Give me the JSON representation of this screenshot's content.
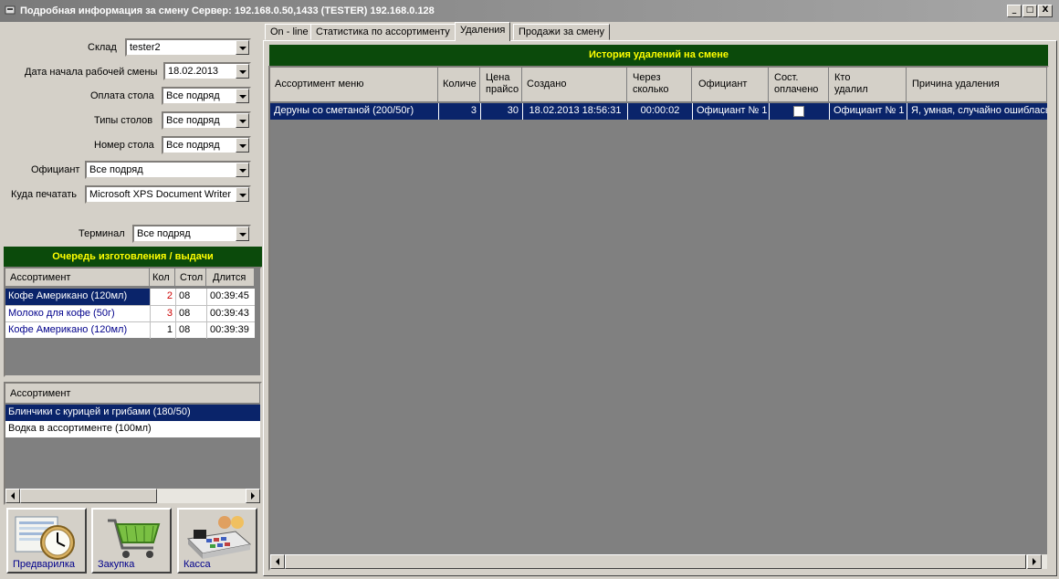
{
  "window": {
    "title": "Подробная информация за смену  Сервер: 192.168.0.50,1433 (TESTER) 192.168.0.128",
    "minimize_glyph": "_",
    "maximize_glyph": "□",
    "close_glyph": "X"
  },
  "filters": {
    "warehouse_label": "Склад",
    "warehouse_value": "tester2",
    "shift_start_label": "Дата начала рабочей смены",
    "shift_start_value": "18.02.2013",
    "table_payment_label": "Оплата стола",
    "table_payment_value": "Все подряд",
    "table_types_label": "Типы столов",
    "table_types_value": "Все подряд",
    "table_number_label": "Номер стола",
    "table_number_value": "Все подряд",
    "waiter_label": "Официант",
    "waiter_value": "Все подряд",
    "print_to_label": "Куда печатать",
    "print_to_value": "Microsoft XPS Document Writer",
    "terminal_label": "Терминал",
    "terminal_value": "Все подряд"
  },
  "queue": {
    "title": "Очередь изготовления / выдачи",
    "columns": [
      "Ассортимент",
      "Кол",
      "Стол",
      "Длится"
    ],
    "rows": [
      {
        "item": "Кофе Американо (120мл)",
        "qty": "2",
        "table": "08",
        "duration": "00:39:45"
      },
      {
        "item": "Молоко для кофе (50г)",
        "qty": "3",
        "table": "08",
        "duration": "00:39:43"
      },
      {
        "item": "Кофе Американо (120мл)",
        "qty": "1",
        "table": "08",
        "duration": "00:39:39"
      }
    ]
  },
  "assortment": {
    "column": "Ассортимент",
    "rows": [
      "Блинчики с курицей и грибами (180/50)",
      "Водка в ассортименте (100мл)"
    ]
  },
  "buttons": {
    "prebooking": "Предварилка",
    "purchase": "Закупка",
    "cashier": "Касса"
  },
  "tabs": [
    "On - line",
    "Статистика по ассортименту",
    "Удаления",
    "Продажи за смену"
  ],
  "active_tab": "Удаления",
  "deletions": {
    "title": "История удалений на смене",
    "columns": [
      "Ассортимент меню",
      "Количе",
      "Цена прайсо",
      "Создано",
      "Через сколько",
      "Официант",
      "Сост. оплачено",
      "Кто удалил",
      "Причина удаления"
    ],
    "rows": [
      {
        "item": "Деруны со сметаной (200/50г)",
        "qty": "3",
        "price": "30",
        "created": "18.02.2013 18:56:31",
        "after": "00:00:02",
        "waiter": "Официант № 1",
        "paid": false,
        "deleted_by": "Официант № 1",
        "reason": "Я, умная, случайно ошиблась"
      }
    ]
  },
  "colors": {
    "selection": "#0a246a",
    "header_green": "#0b4a0b",
    "header_text": "#ffff00",
    "link_blue": "#00008b",
    "qty_red": "#cc0000"
  }
}
